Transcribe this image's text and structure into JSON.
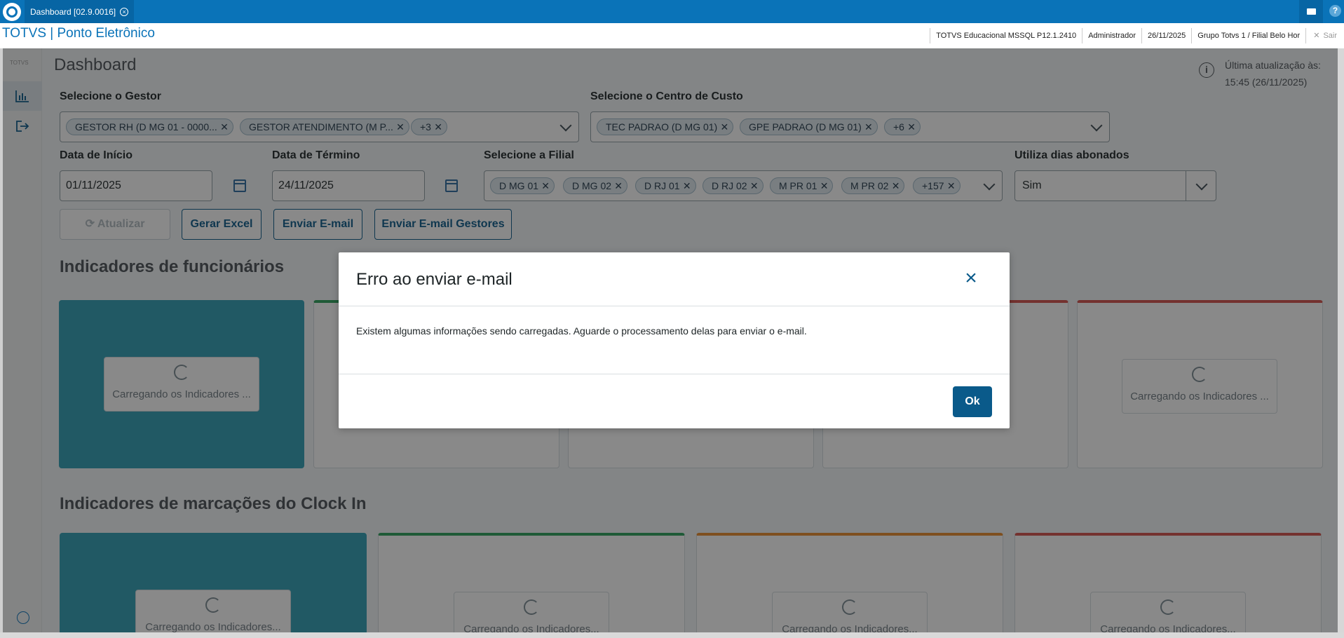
{
  "topbar": {
    "tab_label": "Dashboard [02.9.0016]",
    "tab_close_glyph": "×"
  },
  "header": {
    "app_title": "TOTVS | Ponto Eletrônico",
    "info": [
      "TOTVS Educacional MSSQL P12.1.2410",
      "Administrador",
      "26/11/2025",
      "Grupo Totvs 1 / Filial Belo Hor"
    ],
    "exit_label": "Sair"
  },
  "sidebar": {
    "logo_text": "TOTVS"
  },
  "dashboard": {
    "title": "Dashboard",
    "last_update_label": "Última atualização às:",
    "last_update_value": "15:45 (26/11/2025)",
    "gestor": {
      "label": "Selecione o Gestor",
      "chips": [
        "GESTOR RH (D MG 01 - 0000...",
        "GESTOR ATENDIMENTO (M P...",
        "+3"
      ]
    },
    "centro_custo": {
      "label": "Selecione o Centro de Custo",
      "chips": [
        "TEC PADRAO (D MG 01)",
        "GPE PADRAO (D MG 01)",
        "+6"
      ]
    },
    "data_inicio": {
      "label": "Data de Início",
      "value": "01/11/2025"
    },
    "data_termino": {
      "label": "Data de Término",
      "value": "24/11/2025"
    },
    "filial": {
      "label": "Selecione a Filial",
      "chips": [
        "D MG 01",
        "D MG 02",
        "D RJ 01",
        "D RJ 02",
        "M PR 01",
        "M PR 02",
        "+157"
      ]
    },
    "dias_abonados": {
      "label": "Utiliza dias abonados",
      "value": "Sim"
    },
    "buttons": {
      "atualizar": "Atualizar",
      "gerar_excel": "Gerar Excel",
      "enviar_email": "Enviar E-mail",
      "enviar_email_gestores": "Enviar E-mail Gestores"
    },
    "section_funcionarios": "Indicadores de funcionários",
    "section_clockin": "Indicadores de marcações do Clock In",
    "loading_text": "Carregando os Indicadores ...",
    "loading_text_cut": "Carregando os Indicadores..."
  },
  "modal": {
    "title": "Erro ao enviar e-mail",
    "message": "Existem algumas informações sendo carregadas. Aguarde o processamento delas para enviar o e-mail.",
    "ok_label": "Ok"
  },
  "colors": {
    "brand_blue": "#0a73b8",
    "primary_button": "#0a5a8a",
    "teal_card": "#2e9fb5",
    "green": "#2ba05b",
    "red": "#d4504a",
    "orange": "#e88a2a"
  }
}
